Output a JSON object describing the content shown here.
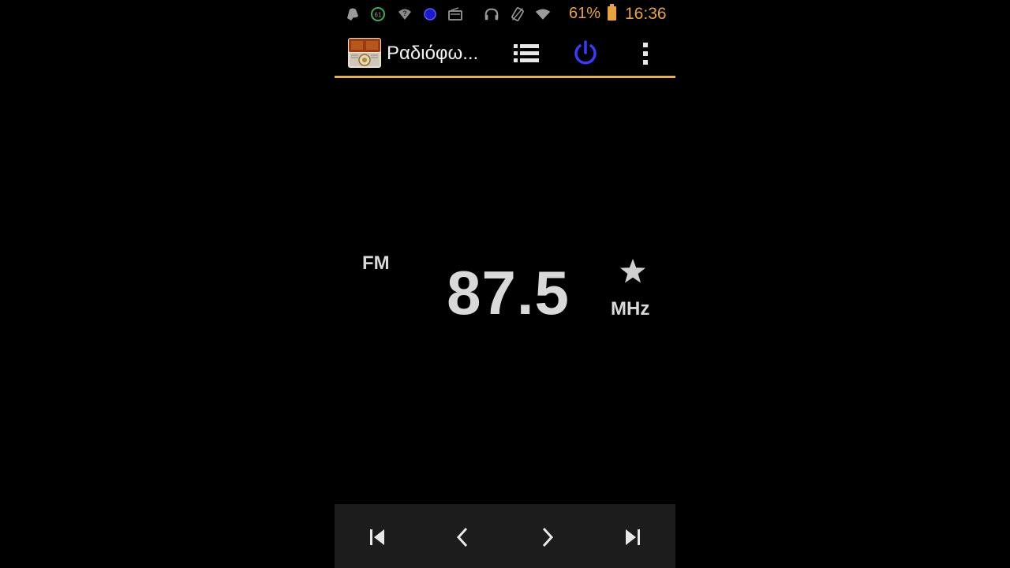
{
  "status_bar": {
    "battery_percent": "61%",
    "time": "16:36",
    "icons": [
      "notification-icon",
      "data-counter-icon",
      "wifi-question-icon",
      "dot-icon",
      "radio-icon",
      "headphones-icon",
      "vibrate-icon",
      "wifi-icon",
      "battery-icon"
    ],
    "data_counter": "61",
    "accent_color": "#e8a33d"
  },
  "action_bar": {
    "title": "Ραδιόφω...",
    "app_icon": "radio-app-icon",
    "buttons": [
      "station-list-icon",
      "power-icon",
      "overflow-menu-icon"
    ],
    "power_color": "#3a3aff",
    "divider_color": "#e8b04a"
  },
  "tuner": {
    "band": "FM",
    "frequency": "87.5",
    "unit": "MHz",
    "favorite_icon": "star-icon"
  },
  "controls": [
    "skip-previous-icon",
    "seek-back-icon",
    "seek-forward-icon",
    "skip-next-icon"
  ]
}
